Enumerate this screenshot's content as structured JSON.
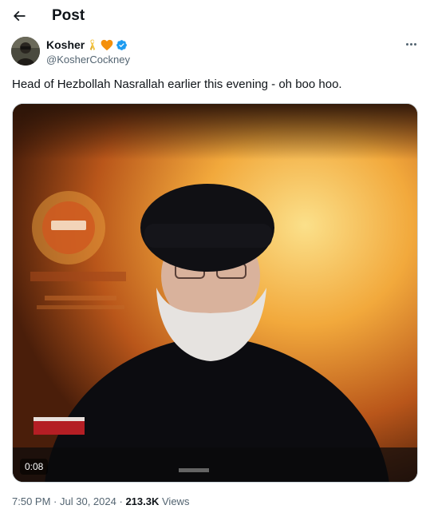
{
  "header": {
    "title": "Post"
  },
  "author": {
    "display_name": "Kosher",
    "handle": "@KosherCockney"
  },
  "tweet": {
    "text": "Head of Hezbollah Nasrallah earlier this evening - oh boo hoo."
  },
  "media": {
    "duration": "0:08"
  },
  "meta": {
    "time": "7:50 PM",
    "separator": "·",
    "date": "Jul 30, 2024",
    "views_count": "213.3K",
    "views_label": "Views"
  },
  "colors": {
    "secondary_text": "#536471",
    "verified_blue": "#1d9bf0",
    "ribbon_yellow": "#f4c542",
    "heart_orange": "#f4900c"
  },
  "icons": {
    "back": "arrow-left-icon",
    "more": "ellipsis-icon",
    "ribbon": "yellow-ribbon-icon",
    "heart": "orange-heart-icon",
    "verified": "verified-badge-icon"
  }
}
